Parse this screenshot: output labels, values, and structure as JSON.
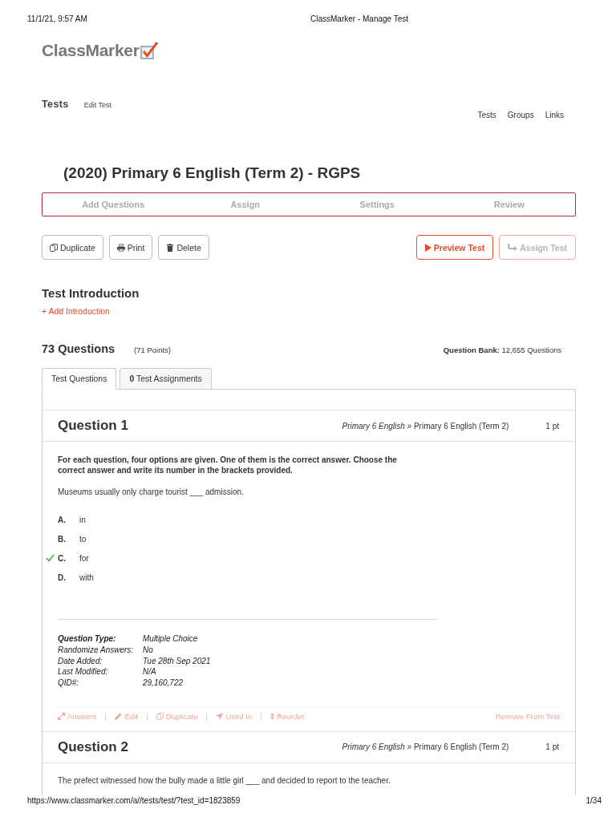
{
  "print_header": {
    "date": "11/1/21, 9:57 AM",
    "title": "ClassMarker - Manage Test"
  },
  "logo": {
    "text": "ClassMarker"
  },
  "breadcrumb": {
    "section": "Tests",
    "page": "Edit Test"
  },
  "top_links": [
    {
      "label": "Tests"
    },
    {
      "label": "Groups"
    },
    {
      "label": "Links"
    }
  ],
  "test_title": "(2020) Primary 6 English (Term 2) - RGPS",
  "steps": [
    {
      "label": "Add Questions"
    },
    {
      "label": "Assign"
    },
    {
      "label": "Settings"
    },
    {
      "label": "Review"
    }
  ],
  "actions_left": [
    {
      "label": "Duplicate"
    },
    {
      "label": "Print"
    },
    {
      "label": "Delete"
    }
  ],
  "actions_right": [
    {
      "label": "Preview Test",
      "disabled": false
    },
    {
      "label": "Assign Test",
      "disabled": true
    }
  ],
  "introduction": {
    "heading": "Test Introduction",
    "link": "+ Add Introduction"
  },
  "summary": {
    "count": "73 Questions",
    "points": "(71 Points)",
    "bank": "**Question Bank:** 12,655 Questions"
  },
  "tabs": [
    {
      "label": "Test Questions",
      "selected": true
    },
    {
      "label": "**0** Test Assignments",
      "selected": false
    }
  ],
  "questions": [
    {
      "title": "Question 1",
      "category": "*Primary 6 English »* Primary 6 English (Term 2)",
      "points": "1 pt",
      "instructions": "For each question, four options are given. One of them is the correct answer. Choose the correct answer and write its number in the brackets provided.",
      "text": "Museums usually only charge tourist ___ admission.",
      "options": [
        {
          "letter": "A.",
          "text": "in",
          "correct": false
        },
        {
          "letter": "B.",
          "text": "to",
          "correct": false
        },
        {
          "letter": "C.",
          "text": "for",
          "correct": true
        },
        {
          "letter": "D.",
          "text": "with",
          "correct": false
        }
      ],
      "meta": [
        {
          "label": "Question Type:",
          "value": "Multiple Choice",
          "bold": true
        },
        {
          "label": "Randomize Answers:",
          "value": "No",
          "bold": false
        },
        {
          "label": "Date Added:",
          "value": "Tue 28th Sep 2021",
          "bold": false
        },
        {
          "label": "Last Modified:",
          "value": "N/A",
          "bold": false
        },
        {
          "label": "QID#:",
          "value": "29,160,722",
          "bold": false
        }
      ],
      "actions": [
        {
          "label": "Answers"
        },
        {
          "label": "Edit"
        },
        {
          "label": "Duplicate"
        },
        {
          "label": "Used In"
        },
        {
          "label": "Reorder"
        }
      ],
      "remove": "Remove From Test"
    },
    {
      "title": "Question 2",
      "category": "*Primary 6 English »* Primary 6 English (Term 2)",
      "points": "1 pt",
      "text": "The prefect witnessed how the bully made a little girl ___ and decided to report to the teacher."
    }
  ],
  "footer": {
    "url": "https://www.classmarker.com/a//tests/test/?test_id=1823859",
    "page": "1/34"
  }
}
